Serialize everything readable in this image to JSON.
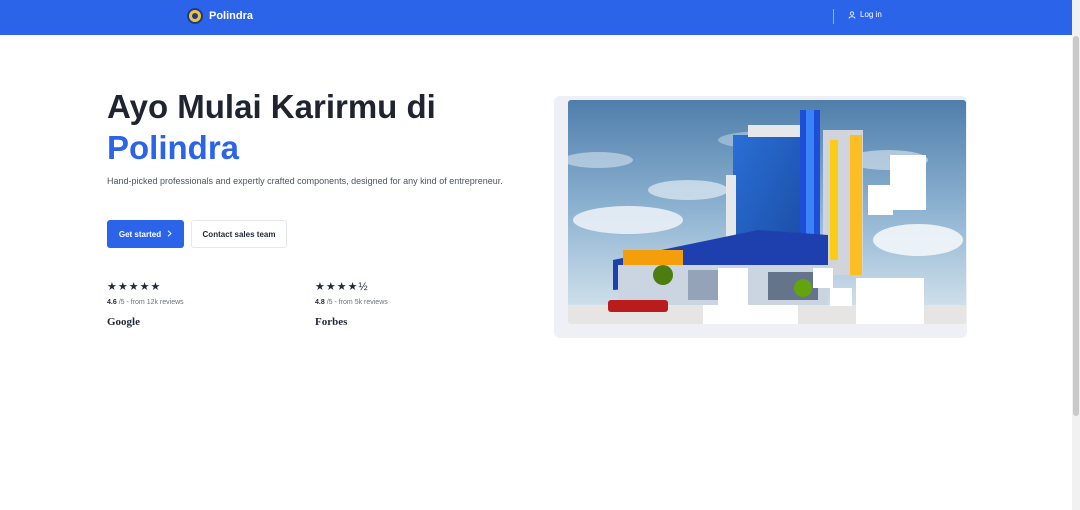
{
  "header": {
    "brand": "Polindra",
    "login_label": "Log in",
    "icons": {
      "logo": "polindra-logo",
      "login": "user-icon"
    },
    "bg_color": "#2b63e9"
  },
  "hero": {
    "title_line1": "Ayo Mulai Karirmu di",
    "title_accent": "Polindra",
    "description": "Hand-picked professionals and expertly crafted components, designed for any kind of entrepreneur.",
    "primary_button": "Get started",
    "primary_button_icon": "chevron-right-icon",
    "secondary_button": "Contact sales team",
    "accent_color": "#2b63e9"
  },
  "reviews": [
    {
      "stars": "★★★★★",
      "score": "4.6",
      "suffix": "/5 - from 12k reviews",
      "brand": "Google"
    },
    {
      "stars": "★★★★½",
      "score": "4.8",
      "suffix": "/5 - from 5k reviews",
      "brand": "Forbes"
    }
  ],
  "image": {
    "subject": "campus-building-photo"
  }
}
